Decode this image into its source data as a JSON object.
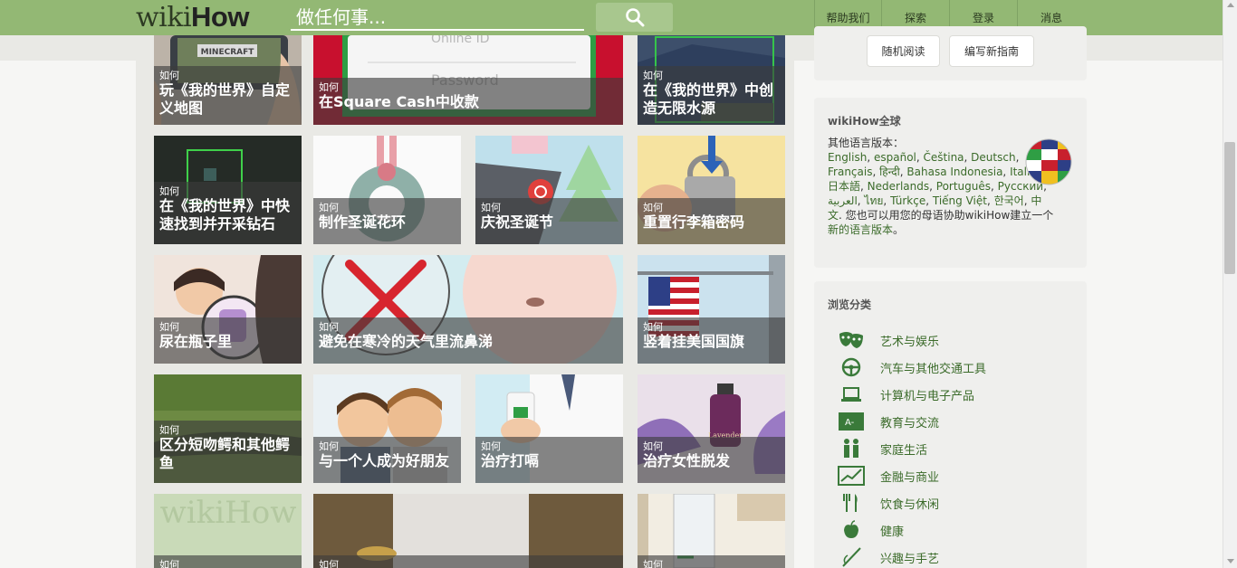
{
  "header": {
    "logo_wiki": "wiki",
    "logo_how": "How",
    "search_placeholder": "做任何事...",
    "nav": [
      "帮助我们",
      "探索",
      "登录",
      "消息"
    ]
  },
  "tiles": [
    {
      "prefix": "如何",
      "title_lines": [
        "玩《我的世界》自定",
        "义地图"
      ]
    },
    {
      "prefix": "如何",
      "title_lines": [
        "在Square Cash中收款"
      ],
      "image_text_1": "Online ID",
      "image_text_2": "Password"
    },
    {
      "prefix": "如何",
      "title_lines": [
        "在《我的世界》中创",
        "造无限水源"
      ]
    },
    {
      "prefix": "如何",
      "title_lines": [
        "在《我的世界》中快",
        "速找到并开采钻石"
      ]
    },
    {
      "prefix": "如何",
      "title_lines": [
        "制作圣诞花环"
      ]
    },
    {
      "prefix": "如何",
      "title_lines": [
        "庆祝圣诞节"
      ]
    },
    {
      "prefix": "如何",
      "title_lines": [
        "重置行李箱密码"
      ]
    },
    {
      "prefix": "如何",
      "title_lines": [
        "尿在瓶子里"
      ]
    },
    {
      "prefix": "如何",
      "title_lines": [
        "避免在寒冷的天气里流鼻涕"
      ]
    },
    {
      "prefix": "如何",
      "title_lines": [
        "竖着挂美国国旗"
      ]
    },
    {
      "prefix": "如何",
      "title_lines": [
        "区分短吻鳄和其他鳄",
        "鱼"
      ]
    },
    {
      "prefix": "如何",
      "title_lines": [
        "与一个人成为好朋友"
      ]
    },
    {
      "prefix": "如何",
      "title_lines": [
        "治疗打嗝"
      ]
    },
    {
      "prefix": "如何",
      "title_lines": [
        "治疗女性脱发"
      ],
      "image_text_1": "Lavender"
    },
    {
      "prefix": "如何",
      "title_lines": [],
      "image_text_1": "wikiHow"
    },
    {
      "prefix": "如何",
      "title_lines": []
    },
    {
      "prefix": "如何",
      "title_lines": []
    }
  ],
  "sidebar": {
    "random_read": "随机阅读",
    "write_new": "编写新指南",
    "global_title": "wikiHow全球",
    "other_lang_label": "其他语言版本：",
    "languages": [
      "English",
      "español",
      "Čeština",
      "Deutsch",
      "Français",
      "हिन्दी",
      "Bahasa Indonesia",
      "Italiano",
      "日本語",
      "Nederlands",
      "Português",
      "Русский",
      "العربية",
      "ไทย",
      "Türkçe",
      "Tiếng Việt",
      "한국어",
      "中文"
    ],
    "help_text_1": "您也可以用您的母语协助wikiHow建立一个",
    "help_link": "新的语言版本",
    "help_text_2": "。",
    "browse_title": "浏览分类",
    "categories": [
      "艺术与娱乐",
      "汽车与其他交通工具",
      "计算机与电子产品",
      "教育与交流",
      "家庭生活",
      "金融与商业",
      "饮食与休闲",
      "健康",
      "兴趣与手艺"
    ]
  },
  "colors": {
    "header_green": "#93b874",
    "link_green": "#3b6b2a",
    "caption_overlay": "rgba(60,60,60,0.62)"
  }
}
